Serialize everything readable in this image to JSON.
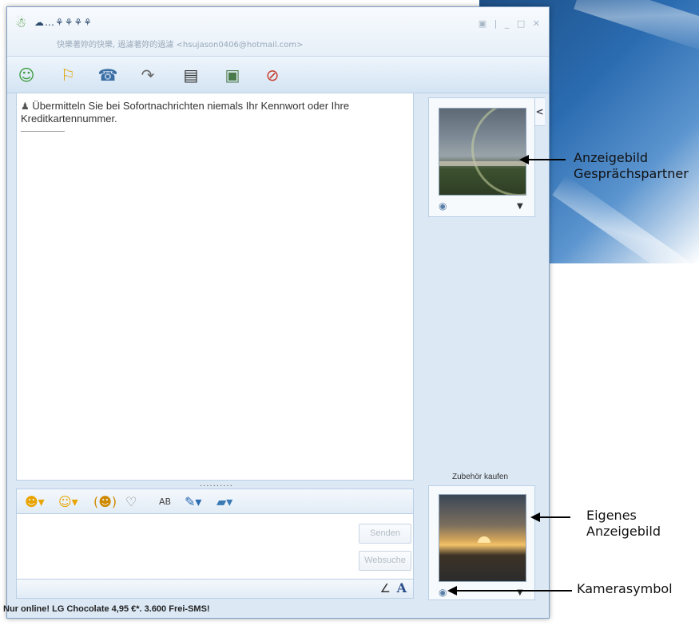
{
  "window": {
    "contact_name": "☁…⚘⚘⚘⚘",
    "contact_status": "快樂著妳的快樂, 過濾著妳的過濾 <hsujason0406@hotmail.com>",
    "window_controls": "▣ | _ □ ✕"
  },
  "toolbar": {
    "icons": [
      "add-contact-icon",
      "share-files-icon",
      "call-icon",
      "phone-icon",
      "video-icon",
      "activities-icon",
      "block-icon"
    ]
  },
  "chat": {
    "warning_text": "Übermitteln Sie bei Sofortnachrichten niemals Ihr Kennwort oder Ihre Kreditkartennummer.",
    "splitter": "··········"
  },
  "input": {
    "send_label": "Senden",
    "search_label": "Websuche",
    "font_label": "A"
  },
  "panel": {
    "accessory_link": "Zubehör kaufen",
    "collapse_label": "<"
  },
  "status_bar": {
    "text": "Nur online! LG Chocolate 4,95 €*. 3.600 Frei-SMS!"
  },
  "callouts": {
    "contact_pic": [
      "Anzeigebild",
      "Gesprächspartner"
    ],
    "own_pic": [
      "Eigenes",
      "Anzeigebild"
    ],
    "camera": "Kamerasymbol"
  },
  "colors": {
    "window_bg": "#dce9f5",
    "accent": "#3b6ea5",
    "border": "#b9cee5"
  }
}
